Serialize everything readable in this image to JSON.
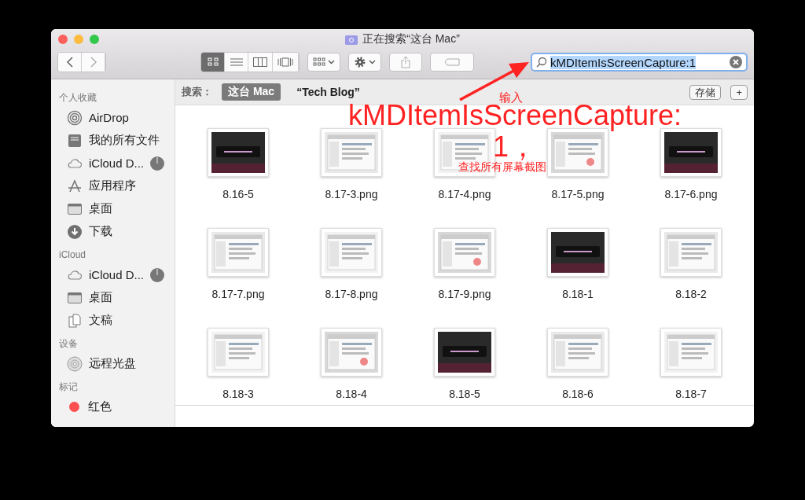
{
  "window": {
    "title": "正在搜索“这台 Mac”"
  },
  "toolbar": {
    "view_modes": [
      {
        "kind": "icons",
        "selected": true
      },
      {
        "kind": "list",
        "selected": false
      },
      {
        "kind": "columns",
        "selected": false
      },
      {
        "kind": "coverflow",
        "selected": false
      }
    ]
  },
  "search": {
    "value": "kMDItemIsScreenCapture:1"
  },
  "sidebar": [
    {
      "title": "个人收藏",
      "items": [
        {
          "kind": "airdrop",
          "label": "AirDrop"
        },
        {
          "kind": "allfiles",
          "label": "我的所有文件"
        },
        {
          "kind": "cloud",
          "label": "iCloud D...",
          "syncing": true
        },
        {
          "kind": "apps",
          "label": "应用程序"
        },
        {
          "kind": "desktop",
          "label": "桌面"
        },
        {
          "kind": "download",
          "label": "下载"
        }
      ]
    },
    {
      "title": "iCloud",
      "items": [
        {
          "kind": "cloud",
          "label": "iCloud D...",
          "syncing": true
        },
        {
          "kind": "desktop",
          "label": "桌面"
        },
        {
          "kind": "docs",
          "label": "文稿"
        }
      ]
    },
    {
      "title": "设备",
      "items": [
        {
          "kind": "disc",
          "label": "远程光盘"
        }
      ]
    },
    {
      "title": "标记",
      "items": [
        {
          "kind": "tag",
          "label": "红色",
          "color": "#fc4f4f"
        }
      ]
    }
  ],
  "scope_bar": {
    "label": "搜索：",
    "scopes": [
      {
        "label": "这台 Mac",
        "selected": true
      },
      {
        "label": "“Tech Blog”",
        "selected": false
      }
    ],
    "buttons": [
      "存储",
      "+"
    ]
  },
  "files": [
    {
      "name": "8.16-5"
    },
    {
      "name": "8.17-3.png"
    },
    {
      "name": "8.17-4.png"
    },
    {
      "name": "8.17-5.png"
    },
    {
      "name": "8.17-6.png"
    },
    {
      "name": "8.17-7.png"
    },
    {
      "name": "8.17-8.png"
    },
    {
      "name": "8.17-9.png"
    },
    {
      "name": "8.18-1"
    },
    {
      "name": "8.18-2"
    },
    {
      "name": "8.18-3"
    },
    {
      "name": "8.18-4"
    },
    {
      "name": "8.18-5"
    },
    {
      "name": "8.18-6"
    },
    {
      "name": "8.18-7"
    }
  ],
  "annotation": {
    "hint": "输入",
    "query_lines": [
      "kMDItemIsScreenCapture:",
      "1，"
    ],
    "caption": "查找所有屏幕截图"
  }
}
